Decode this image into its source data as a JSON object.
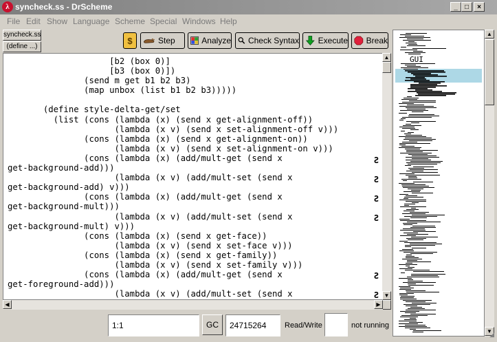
{
  "window": {
    "title": "syncheck.ss - DrScheme"
  },
  "menus": [
    "File",
    "Edit",
    "Show",
    "Language",
    "Scheme",
    "Special",
    "Windows",
    "Help"
  ],
  "toolbar": {
    "file_button": "syncheck.ss",
    "define_button": "(define ...)",
    "step": "Step",
    "analyze": "Analyze",
    "check_syntax": "Check Syntax",
    "execute": "Execute",
    "break": "Break"
  },
  "editor": {
    "lines": [
      "                    [b2 (box 0)]",
      "                    [b3 (box 0)])",
      "               (send m get b1 b2 b3)",
      "               (map unbox (list b1 b2 b3)))))",
      "",
      "       (define style-delta-get/set",
      "         (list (cons (lambda (x) (send x get-alignment-off))",
      "                     (lambda (x v) (send x set-alignment-off v)))",
      "               (cons (lambda (x) (send x get-alignment-on))",
      "                     (lambda (x v) (send x set-alignment-on v)))",
      "               (cons (lambda (x) (add/mult-get (send x",
      "get-background-add)))",
      "                     (lambda (x v) (add/mult-set (send x",
      "get-background-add) v)))",
      "               (cons (lambda (x) (add/mult-get (send x",
      "get-background-mult)))",
      "                     (lambda (x v) (add/mult-set (send x",
      "get-background-mult) v)))",
      "               (cons (lambda (x) (send x get-face))",
      "                     (lambda (x v) (send x set-face v)))",
      "               (cons (lambda (x) (send x get-family))",
      "                     (lambda (x v) (send x set-family v)))",
      "               (cons (lambda (x) (add/mult-get (send x",
      "get-foreground-add)))",
      "                     (lambda (x v) (add/mult-set (send x"
    ],
    "wrap_marker": "Ƨ"
  },
  "overview": {
    "label": "GUI"
  },
  "status": {
    "position": "1:1",
    "gc_button": "GC",
    "memory": "24715264",
    "mode": "Read/Write",
    "state": "not running"
  }
}
